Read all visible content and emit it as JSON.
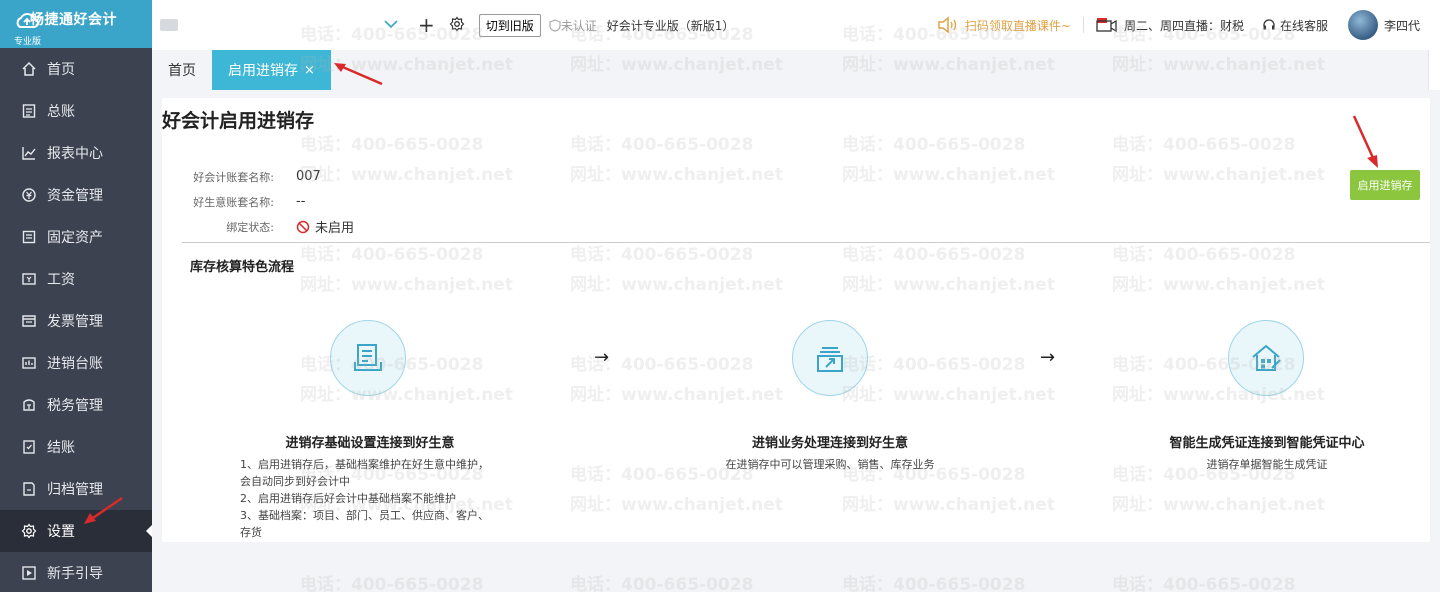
{
  "app": {
    "logo_title": "畅捷通好会计",
    "logo_sub": "专业版"
  },
  "sidebar": {
    "items": [
      {
        "label": "首页",
        "icon": "home-icon"
      },
      {
        "label": "总账",
        "icon": "ledger-icon"
      },
      {
        "label": "报表中心",
        "icon": "chart-icon"
      },
      {
        "label": "资金管理",
        "icon": "money-icon"
      },
      {
        "label": "固定资产",
        "icon": "asset-icon"
      },
      {
        "label": "工资",
        "icon": "salary-icon"
      },
      {
        "label": "发票管理",
        "icon": "invoice-icon"
      },
      {
        "label": "进销台账",
        "icon": "inventory-icon"
      },
      {
        "label": "税务管理",
        "icon": "tax-icon"
      },
      {
        "label": "结账",
        "icon": "close-books-icon"
      },
      {
        "label": "归档管理",
        "icon": "archive-icon"
      },
      {
        "label": "设置",
        "icon": "gear-icon",
        "active": true
      },
      {
        "label": "新手引导",
        "icon": "guide-icon"
      }
    ]
  },
  "topbar": {
    "switch_old": "切到旧版",
    "unverified": "未认证",
    "version": "好会计专业版（新版1）",
    "promo": "扫码领取直播课件~",
    "live": "周二、周四直播：财税",
    "service": "在线客服",
    "user_name": "李四代"
  },
  "tabs": [
    {
      "label": "首页"
    },
    {
      "label": "启用进销存",
      "close": "×",
      "active": true
    }
  ],
  "page": {
    "title": "好会计启用进销存",
    "enable_button": "启用进销存",
    "info": [
      {
        "label": "好会计账套名称:",
        "value": "007"
      },
      {
        "label": "好生意账套名称:",
        "value": "--"
      },
      {
        "label": "绑定状态:",
        "value": "未启用"
      }
    ],
    "section_title": "库存核算特色流程",
    "arrow_glyph": "→",
    "steps": [
      {
        "title": "进销存基础设置连接到好生意",
        "desc": [
          "1、启用进销存后，基础档案维护在好生意中维护，",
          "会自动同步到好会计中",
          "2、启用进销存后好会计中基础档案不能维护",
          "3、基础档案：项目、部门、员工、供应商、客户、",
          "存货"
        ]
      },
      {
        "title": "进销业务处理连接到好生意",
        "desc": [
          "在进销存中可以管理采购、销售、库存业务"
        ]
      },
      {
        "title": "智能生成凭证连接到智能凭证中心",
        "desc": [
          "进销存单据智能生成凭证"
        ]
      }
    ]
  },
  "watermark": {
    "phone": "电话：400-665-0028",
    "site": "网址：www.chanjet.net"
  },
  "colors": {
    "sidebar_bg": "#3c4250",
    "brand_teal": "#3aa5c8",
    "active_tab": "#3db7d5",
    "enable_button": "#8cc63e",
    "promo_orange": "#e0a243",
    "annotation_red": "#d92b2b"
  }
}
